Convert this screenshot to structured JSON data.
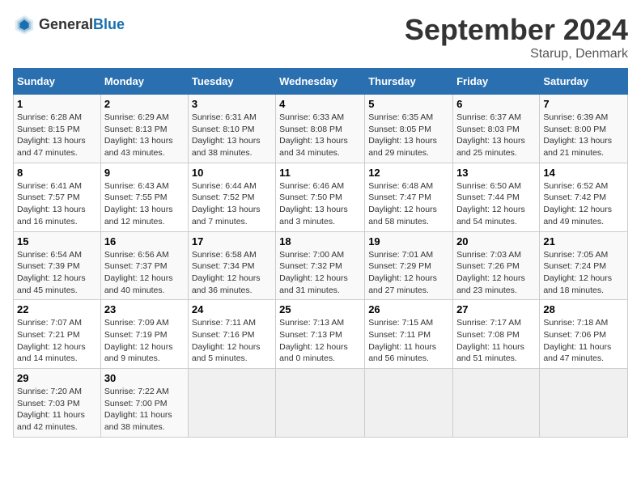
{
  "header": {
    "logo_general": "General",
    "logo_blue": "Blue",
    "title": "September 2024",
    "subtitle": "Starup, Denmark"
  },
  "columns": [
    "Sunday",
    "Monday",
    "Tuesday",
    "Wednesday",
    "Thursday",
    "Friday",
    "Saturday"
  ],
  "weeks": [
    [
      {
        "day": "1",
        "sunrise": "Sunrise: 6:28 AM",
        "sunset": "Sunset: 8:15 PM",
        "daylight": "Daylight: 13 hours and 47 minutes."
      },
      {
        "day": "2",
        "sunrise": "Sunrise: 6:29 AM",
        "sunset": "Sunset: 8:13 PM",
        "daylight": "Daylight: 13 hours and 43 minutes."
      },
      {
        "day": "3",
        "sunrise": "Sunrise: 6:31 AM",
        "sunset": "Sunset: 8:10 PM",
        "daylight": "Daylight: 13 hours and 38 minutes."
      },
      {
        "day": "4",
        "sunrise": "Sunrise: 6:33 AM",
        "sunset": "Sunset: 8:08 PM",
        "daylight": "Daylight: 13 hours and 34 minutes."
      },
      {
        "day": "5",
        "sunrise": "Sunrise: 6:35 AM",
        "sunset": "Sunset: 8:05 PM",
        "daylight": "Daylight: 13 hours and 29 minutes."
      },
      {
        "day": "6",
        "sunrise": "Sunrise: 6:37 AM",
        "sunset": "Sunset: 8:03 PM",
        "daylight": "Daylight: 13 hours and 25 minutes."
      },
      {
        "day": "7",
        "sunrise": "Sunrise: 6:39 AM",
        "sunset": "Sunset: 8:00 PM",
        "daylight": "Daylight: 13 hours and 21 minutes."
      }
    ],
    [
      {
        "day": "8",
        "sunrise": "Sunrise: 6:41 AM",
        "sunset": "Sunset: 7:57 PM",
        "daylight": "Daylight: 13 hours and 16 minutes."
      },
      {
        "day": "9",
        "sunrise": "Sunrise: 6:43 AM",
        "sunset": "Sunset: 7:55 PM",
        "daylight": "Daylight: 13 hours and 12 minutes."
      },
      {
        "day": "10",
        "sunrise": "Sunrise: 6:44 AM",
        "sunset": "Sunset: 7:52 PM",
        "daylight": "Daylight: 13 hours and 7 minutes."
      },
      {
        "day": "11",
        "sunrise": "Sunrise: 6:46 AM",
        "sunset": "Sunset: 7:50 PM",
        "daylight": "Daylight: 13 hours and 3 minutes."
      },
      {
        "day": "12",
        "sunrise": "Sunrise: 6:48 AM",
        "sunset": "Sunset: 7:47 PM",
        "daylight": "Daylight: 12 hours and 58 minutes."
      },
      {
        "day": "13",
        "sunrise": "Sunrise: 6:50 AM",
        "sunset": "Sunset: 7:44 PM",
        "daylight": "Daylight: 12 hours and 54 minutes."
      },
      {
        "day": "14",
        "sunrise": "Sunrise: 6:52 AM",
        "sunset": "Sunset: 7:42 PM",
        "daylight": "Daylight: 12 hours and 49 minutes."
      }
    ],
    [
      {
        "day": "15",
        "sunrise": "Sunrise: 6:54 AM",
        "sunset": "Sunset: 7:39 PM",
        "daylight": "Daylight: 12 hours and 45 minutes."
      },
      {
        "day": "16",
        "sunrise": "Sunrise: 6:56 AM",
        "sunset": "Sunset: 7:37 PM",
        "daylight": "Daylight: 12 hours and 40 minutes."
      },
      {
        "day": "17",
        "sunrise": "Sunrise: 6:58 AM",
        "sunset": "Sunset: 7:34 PM",
        "daylight": "Daylight: 12 hours and 36 minutes."
      },
      {
        "day": "18",
        "sunrise": "Sunrise: 7:00 AM",
        "sunset": "Sunset: 7:32 PM",
        "daylight": "Daylight: 12 hours and 31 minutes."
      },
      {
        "day": "19",
        "sunrise": "Sunrise: 7:01 AM",
        "sunset": "Sunset: 7:29 PM",
        "daylight": "Daylight: 12 hours and 27 minutes."
      },
      {
        "day": "20",
        "sunrise": "Sunrise: 7:03 AM",
        "sunset": "Sunset: 7:26 PM",
        "daylight": "Daylight: 12 hours and 23 minutes."
      },
      {
        "day": "21",
        "sunrise": "Sunrise: 7:05 AM",
        "sunset": "Sunset: 7:24 PM",
        "daylight": "Daylight: 12 hours and 18 minutes."
      }
    ],
    [
      {
        "day": "22",
        "sunrise": "Sunrise: 7:07 AM",
        "sunset": "Sunset: 7:21 PM",
        "daylight": "Daylight: 12 hours and 14 minutes."
      },
      {
        "day": "23",
        "sunrise": "Sunrise: 7:09 AM",
        "sunset": "Sunset: 7:19 PM",
        "daylight": "Daylight: 12 hours and 9 minutes."
      },
      {
        "day": "24",
        "sunrise": "Sunrise: 7:11 AM",
        "sunset": "Sunset: 7:16 PM",
        "daylight": "Daylight: 12 hours and 5 minutes."
      },
      {
        "day": "25",
        "sunrise": "Sunrise: 7:13 AM",
        "sunset": "Sunset: 7:13 PM",
        "daylight": "Daylight: 12 hours and 0 minutes."
      },
      {
        "day": "26",
        "sunrise": "Sunrise: 7:15 AM",
        "sunset": "Sunset: 7:11 PM",
        "daylight": "Daylight: 11 hours and 56 minutes."
      },
      {
        "day": "27",
        "sunrise": "Sunrise: 7:17 AM",
        "sunset": "Sunset: 7:08 PM",
        "daylight": "Daylight: 11 hours and 51 minutes."
      },
      {
        "day": "28",
        "sunrise": "Sunrise: 7:18 AM",
        "sunset": "Sunset: 7:06 PM",
        "daylight": "Daylight: 11 hours and 47 minutes."
      }
    ],
    [
      {
        "day": "29",
        "sunrise": "Sunrise: 7:20 AM",
        "sunset": "Sunset: 7:03 PM",
        "daylight": "Daylight: 11 hours and 42 minutes."
      },
      {
        "day": "30",
        "sunrise": "Sunrise: 7:22 AM",
        "sunset": "Sunset: 7:00 PM",
        "daylight": "Daylight: 11 hours and 38 minutes."
      },
      null,
      null,
      null,
      null,
      null
    ]
  ]
}
